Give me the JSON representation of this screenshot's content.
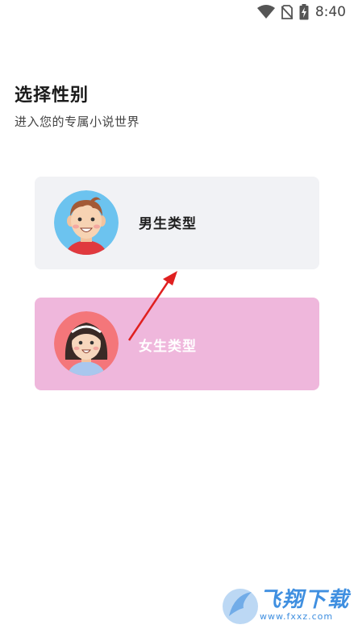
{
  "status_bar": {
    "time": "8:40",
    "icons": [
      "wifi-icon",
      "no-sim-icon",
      "battery-charging-icon"
    ]
  },
  "header": {
    "title": "选择性别",
    "subtitle": "进入您的专属小说世界"
  },
  "options": [
    {
      "label": "男生类型",
      "avatar": "boy-avatar",
      "background": "#f1f2f5"
    },
    {
      "label": "女生类型",
      "avatar": "girl-avatar",
      "background": "#efb7dc"
    }
  ],
  "watermark": {
    "text": "飞翔下载",
    "url": "www.fxxz.com",
    "color": "#3f8fe0"
  },
  "annotation": {
    "arrow_color": "#e02020"
  }
}
